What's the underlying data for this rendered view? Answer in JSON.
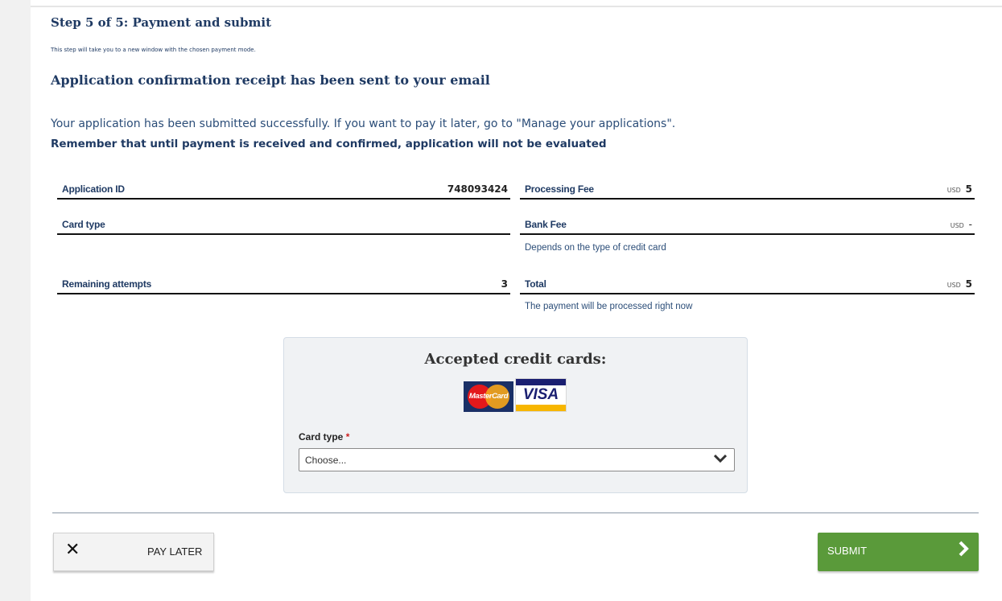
{
  "header": {
    "step_title": "Step 5 of 5: Payment and submit",
    "step_subtitle": "This step will take you to a new window with the chosen payment mode.",
    "confirm_title": "Application confirmation receipt has been sent to your email",
    "success_message": "Your application has been submitted successfully. If you want to pay it later, go to \"Manage your applications\".",
    "remember_message": "Remember that until payment is received and confirmed, application will not be evaluated"
  },
  "summary": {
    "application_id_label": "Application ID",
    "application_id_value": "748093424",
    "card_type_label": "Card type",
    "card_type_value": "",
    "remaining_attempts_label": "Remaining attempts",
    "remaining_attempts_value": "3",
    "processing_fee_label": "Processing Fee",
    "processing_fee_currency": "USD",
    "processing_fee_value": "5",
    "bank_fee_label": "Bank Fee",
    "bank_fee_currency": "USD",
    "bank_fee_value": "-",
    "bank_fee_note": "Depends on the type of credit card",
    "total_label": "Total",
    "total_currency": "USD",
    "total_value": "5",
    "total_note": "The payment will be processed right now"
  },
  "payment_panel": {
    "title": "Accepted credit cards:",
    "mastercard_text": "MasterCard",
    "visa_text": "VISA",
    "card_type_label": "Card type",
    "required_mark": "*",
    "card_type_selected": "Choose...",
    "icons": {
      "dropdown": "chevron-down-icon"
    }
  },
  "actions": {
    "pay_later_label": "PAY LATER",
    "submit_label": "SUBMIT",
    "icons": {
      "pay_later": "close-icon",
      "submit": "chevron-right-icon"
    }
  },
  "colors": {
    "heading": "#1f3a63",
    "submit_bg": "#5a9a3a",
    "required": "#cc1f1f",
    "panel_bg": "#f0f2f4"
  }
}
